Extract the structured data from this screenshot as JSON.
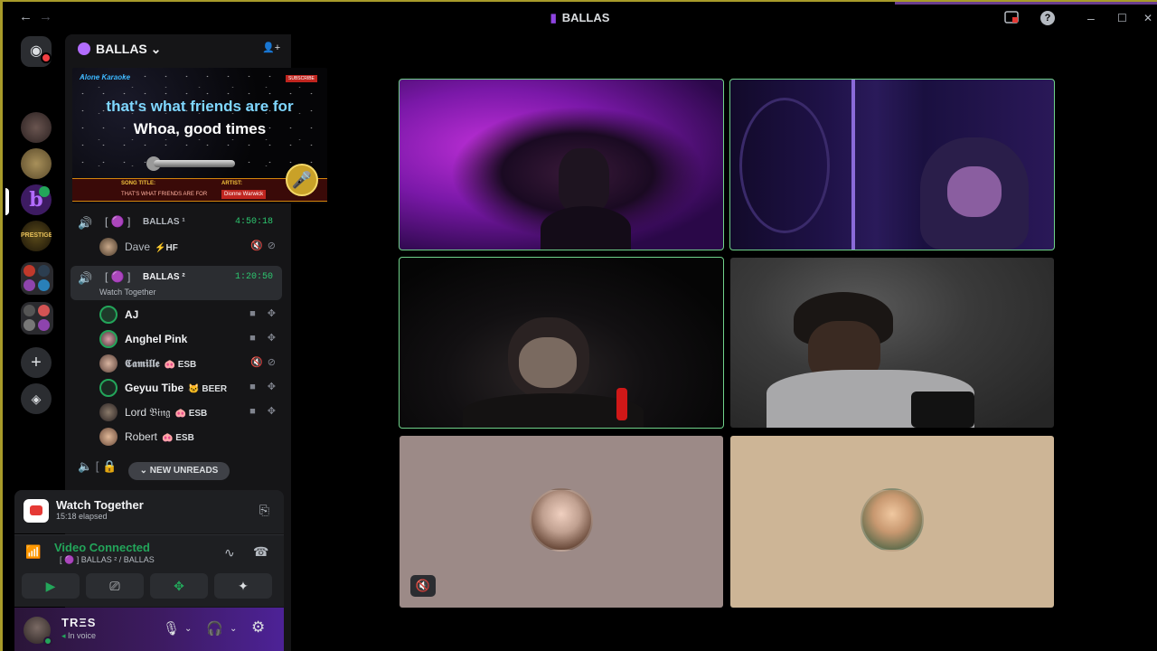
{
  "window": {
    "title": "BALLAS",
    "back_icon": "←",
    "forward_icon": "→",
    "minimize_icon": "–",
    "maximize_icon": "☐",
    "close_icon": "✕",
    "help_icon": "?"
  },
  "server": {
    "name": "BALLAS ⌄",
    "invite_icon": "👤+"
  },
  "karaoke": {
    "logo": "Alone Karaoke",
    "live": "SUBSCRIBE",
    "line1": "that's what friends are for",
    "line2": "Whoa, good times",
    "song_label": "SONG TITLE:",
    "song_title": "THAT'S WHAT FRIENDS ARE FOR",
    "artist_label": "ARTIST:",
    "artist": "Dionne Warwick"
  },
  "voice_channels": [
    {
      "bracket": "[ 🟣 ]",
      "name": "BALLAS ¹",
      "time": "4:50:18"
    },
    {
      "bracket": "[ 🟣 ]",
      "name": "BALLAS ²",
      "time": "1:20:50",
      "activity": "Watch Together"
    }
  ],
  "channel1_members": [
    {
      "name": "Dave",
      "tag": "⚡HF",
      "icons": "🔇⊘"
    }
  ],
  "channel2_members": [
    {
      "name": "AJ",
      "tag": "",
      "icons": "■ ✥"
    },
    {
      "name": "Anghel Pink",
      "tag": "",
      "icons": "■ ✥"
    },
    {
      "name": "𝕮𝖆𝖒𝖎𝖑𝖑𝖊",
      "tag": "🐽 ESB",
      "icons": "🔇⊘"
    },
    {
      "name": "Geyuu Tibe",
      "tag": "🐱 BEER",
      "icons": "■ ✥"
    },
    {
      "name": "Lord 𝔅𝔦𝔫𝔤",
      "tag": "🐽 ESB",
      "icons": "■ ✥"
    },
    {
      "name": "Robert",
      "tag": "🐽 ESB",
      "icons": ""
    }
  ],
  "new_unreads": "⌄ NEW UNREADS",
  "locked_row": "🔈 [ 🔒",
  "watch_together": {
    "title": "Watch Together",
    "elapsed": "15:18 elapsed"
  },
  "voice_connection": {
    "status": "Video Connected",
    "path": "[ 🟣 ]  BALLAS ² / BALLAS",
    "buttons": [
      "▶",
      "⎚",
      "✥",
      "✦"
    ]
  },
  "user": {
    "name": "TRΞS",
    "status": "In voice"
  },
  "colors": {
    "speaking_outline": "#6fd28a",
    "connected_green": "#23a55a",
    "background": "#000000"
  }
}
